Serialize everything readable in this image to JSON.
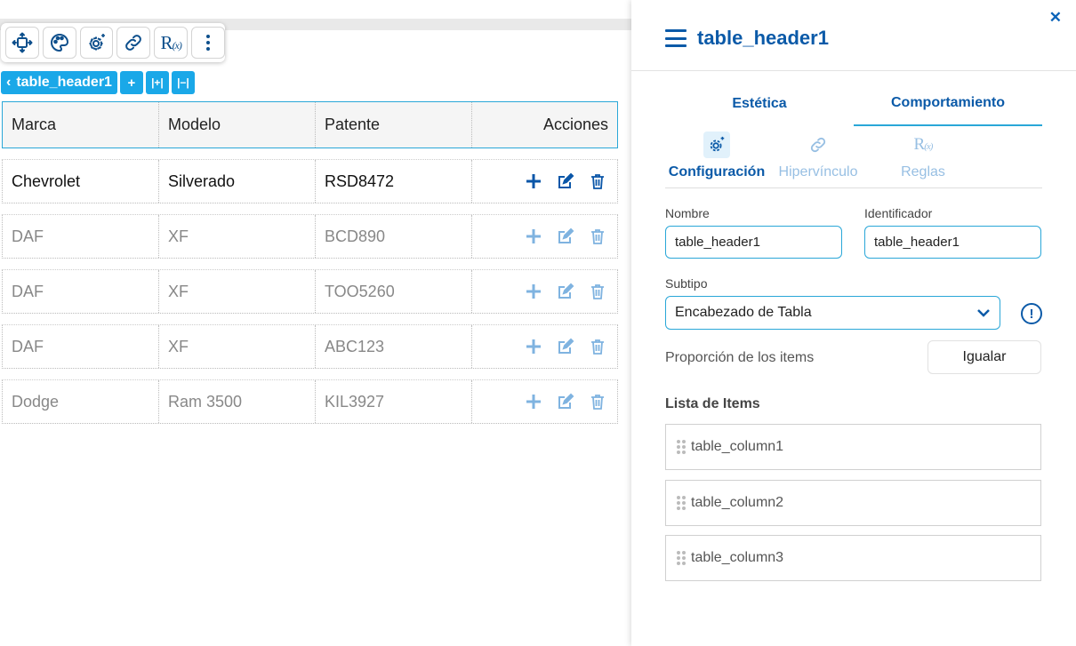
{
  "toolbar": {
    "buttons": [
      {
        "icon": "move-icon"
      },
      {
        "icon": "palette-icon"
      },
      {
        "icon": "gear-sparkle-icon"
      },
      {
        "icon": "link-icon"
      },
      {
        "icon": "rules-icon",
        "text": "R",
        "sub": "(x)"
      },
      {
        "icon": "more-vertical-icon"
      }
    ]
  },
  "breadcrumb": {
    "label": "table_header1",
    "back_glyph": "‹",
    "add_glyph": "+",
    "expand_glyph": "|+|",
    "shrink_glyph": "|−|"
  },
  "table": {
    "headers": [
      "Marca",
      "Modelo",
      "Patente",
      "Acciones"
    ],
    "rows": [
      [
        "Chevrolet",
        "Silverado",
        "RSD8472"
      ],
      [
        "DAF",
        "XF",
        "BCD890"
      ],
      [
        "DAF",
        "XF",
        "TOO5260"
      ],
      [
        "DAF",
        "XF",
        "ABC123"
      ],
      [
        "Dodge",
        "Ram 3500",
        "KIL3927"
      ]
    ],
    "row_actions": [
      "plus-icon",
      "edit-icon",
      "trash-icon"
    ]
  },
  "panel": {
    "close_glyph": "✕",
    "title": "table_header1",
    "tabs": [
      {
        "label": "Estética",
        "active": false
      },
      {
        "label": "Comportamiento",
        "active": true
      }
    ],
    "subtabs": [
      {
        "label": "Configuración",
        "icon": "gear-sparkle-icon",
        "active": true
      },
      {
        "label": "Hipervínculo",
        "icon": "link-icon",
        "active": false
      },
      {
        "label": "Reglas",
        "icon": "rules-icon",
        "rx": "R",
        "sub": "(x)",
        "active": false
      }
    ],
    "nombre": {
      "label": "Nombre",
      "value": "table_header1"
    },
    "identificador": {
      "label": "Identificador",
      "value": "table_header1"
    },
    "subtipo": {
      "label": "Subtipo",
      "value": "Encabezado de Tabla",
      "info_glyph": "!"
    },
    "proporcion": {
      "label": "Proporción de los items",
      "button": "Igualar"
    },
    "lista": {
      "title": "Lista de Items",
      "items": [
        "table_column1",
        "table_column2",
        "table_column3"
      ]
    }
  },
  "colors": {
    "primary": "#0b5aa8",
    "accent": "#1aa8e8",
    "border_active": "#2aa7d8",
    "muted_icon": "#97bfe3"
  }
}
